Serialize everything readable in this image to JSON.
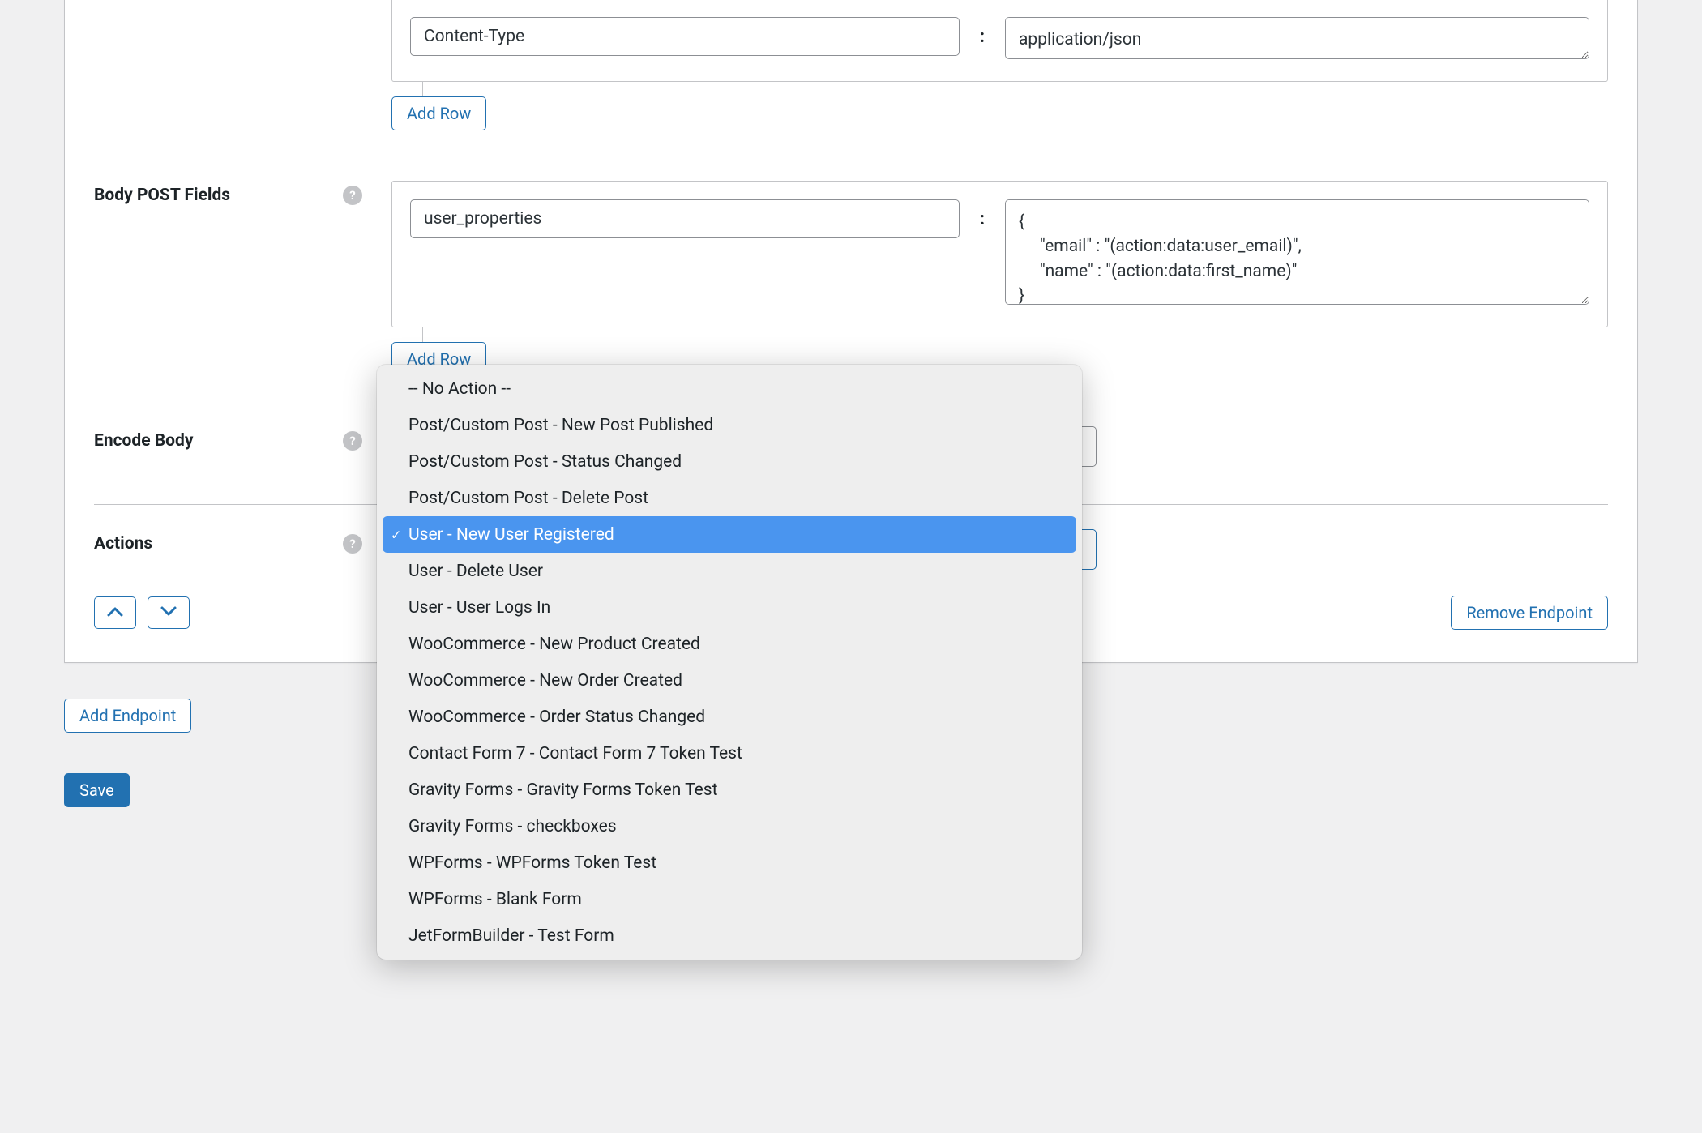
{
  "headers": {
    "key": "Content-Type",
    "value": "application/json",
    "add_row_label": "Add Row"
  },
  "body_fields": {
    "label": "Body POST Fields",
    "key": "user_properties",
    "value": "{\n     \"email\" : \"(action:data:user_email)\",\n     \"name\" : \"(action:data:first_name)\"\n}",
    "add_row_label": "Add Row"
  },
  "encode_body": {
    "label": "Encode Body"
  },
  "actions": {
    "label": "Actions",
    "options": [
      "-- No Action --",
      "Post/Custom Post - New Post Published",
      "Post/Custom Post - Status Changed",
      "Post/Custom Post - Delete Post",
      "User - New User Registered",
      "User - Delete User",
      "User - User Logs In",
      "WooCommerce - New Product Created",
      "WooCommerce - New Order Created",
      "WooCommerce - Order Status Changed",
      "Contact Form 7 - Contact Form 7 Token Test",
      "Gravity Forms - Gravity Forms Token Test",
      "Gravity Forms - checkboxes",
      "WPForms - WPForms Token Test",
      "WPForms - Blank Form",
      "JetFormBuilder - Test Form"
    ],
    "selected_index": 4
  },
  "buttons": {
    "remove_endpoint": "Remove Endpoint",
    "add_endpoint": "Add Endpoint",
    "save": "Save"
  },
  "kv_separator": ":"
}
